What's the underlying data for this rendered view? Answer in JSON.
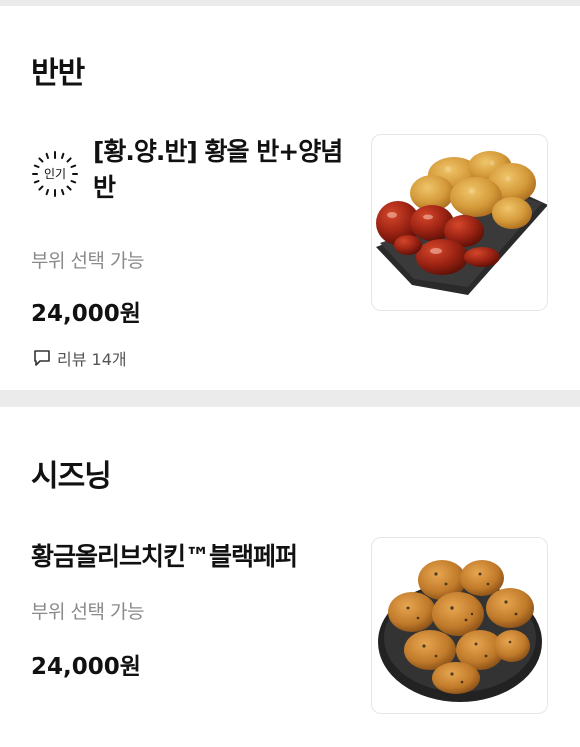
{
  "sections": [
    {
      "title": "반반",
      "item": {
        "badge": "인기",
        "name": "[황.양.반] 황올 반+양념 반",
        "option": "부위 선택 가능",
        "price": "24,000원",
        "reviews": "리뷰 14개",
        "image_icon": "fried-chicken-half-half-image"
      }
    },
    {
      "title": "시즈닝",
      "item": {
        "name": "황금올리브치킨™블랙페퍼",
        "option": "부위 선택 가능",
        "price": "24,000원",
        "image_icon": "black-pepper-chicken-image"
      }
    }
  ],
  "colors": {
    "background": "#ebebeb",
    "card": "#ffffff",
    "subtext": "#8a8a8a",
    "fried": "#d9a040",
    "sauce": "#9c2415"
  }
}
